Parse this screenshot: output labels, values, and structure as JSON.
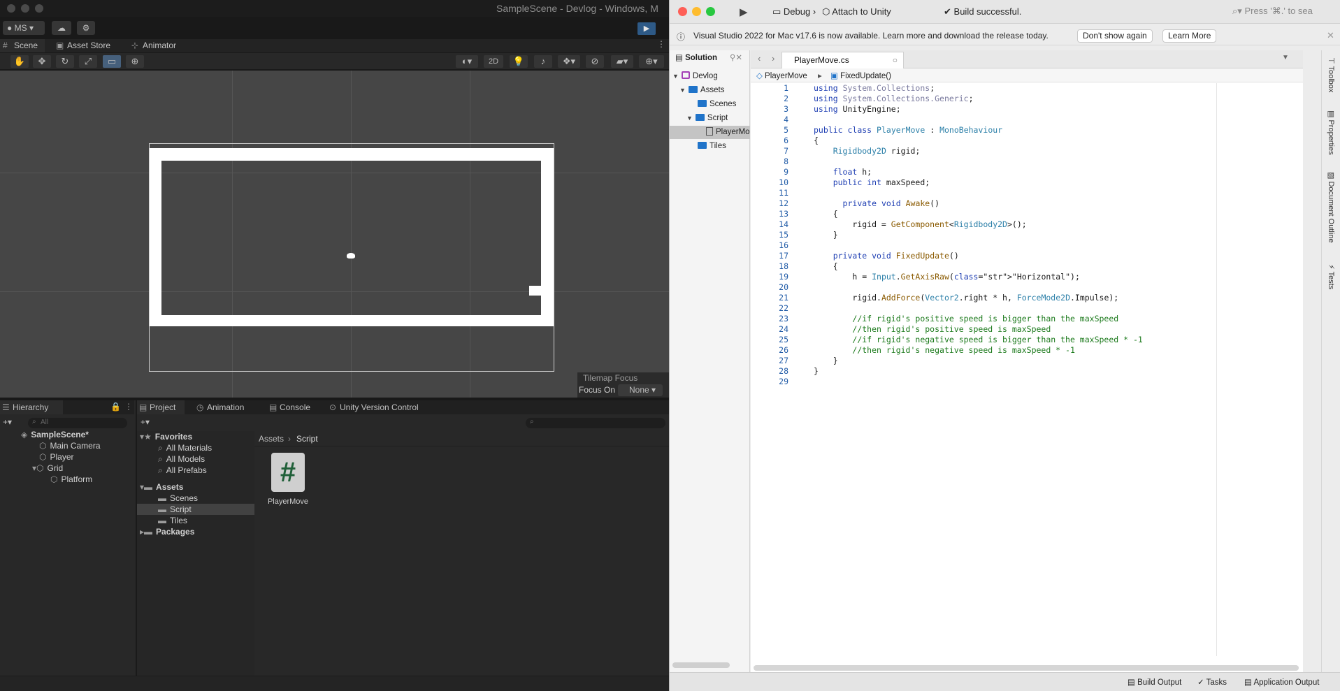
{
  "unity": {
    "window_title": "SampleScene - Devlog - Windows, M",
    "account": "MS",
    "scene_tabs": [
      {
        "label": "Scene",
        "icon": "hash-icon"
      },
      {
        "label": "Asset Store",
        "icon": "bag-icon"
      },
      {
        "label": "Animator",
        "icon": "animator-icon"
      }
    ],
    "scene_toolbar": {
      "mode_2d": "2D"
    },
    "tilemap_focus": {
      "title": "Tilemap Focus",
      "label": "Focus On",
      "value": "None"
    },
    "hierarchy": {
      "tab": "Hierarchy",
      "search_placeholder": "All",
      "items": [
        {
          "label": "SampleScene*"
        },
        {
          "label": "Main Camera"
        },
        {
          "label": "Player"
        },
        {
          "label": "Grid"
        },
        {
          "label": "Platform"
        }
      ]
    },
    "project_tabs": [
      {
        "label": "Project"
      },
      {
        "label": "Animation"
      },
      {
        "label": "Console"
      },
      {
        "label": "Unity Version Control"
      }
    ],
    "project_tree": {
      "favorites": "Favorites",
      "favorite_items": [
        "All Materials",
        "All Models",
        "All Prefabs"
      ],
      "assets": "Assets",
      "asset_items": [
        "Scenes",
        "Script",
        "Tiles"
      ],
      "packages": "Packages"
    },
    "breadcrumb": {
      "root": "Assets",
      "current": "Script"
    },
    "asset": {
      "glyph": "#",
      "label": "PlayerMove"
    }
  },
  "vs": {
    "run_config": "Debug",
    "target": "Attach to Unity",
    "build_status": "Build successful.",
    "search_placeholder": "Press '⌘.' to sea",
    "info": {
      "message": "Visual Studio 2022 for Mac v17.6 is now available. Learn more and download the release today.",
      "dont_show": "Don't show again",
      "learn_more": "Learn More"
    },
    "solution": {
      "title": "Solution",
      "items": [
        {
          "label": "Devlog"
        },
        {
          "label": "Assets"
        },
        {
          "label": "Scenes"
        },
        {
          "label": "Script"
        },
        {
          "label": "PlayerMo"
        },
        {
          "label": "Tiles"
        }
      ]
    },
    "editor": {
      "tab": "PlayerMove.cs",
      "breadcrumb_class": "PlayerMove",
      "breadcrumb_method": "FixedUpdate()"
    },
    "right_bar": [
      "Toolbox",
      "Properties",
      "Document Outline",
      "Tests"
    ],
    "status": {
      "build_output": "Build Output",
      "tasks": "Tasks",
      "app_output": "Application Output"
    },
    "code_lines": [
      "using System.Collections;",
      "using System.Collections.Generic;",
      "using UnityEngine;",
      "",
      "public class PlayerMove : MonoBehaviour",
      "{",
      "    Rigidbody2D rigid;",
      "",
      "    float h;",
      "    public int maxSpeed;",
      "",
      "      private void Awake()",
      "    {",
      "        rigid = GetComponent<Rigidbody2D>();",
      "    }",
      "",
      "    private void FixedUpdate()",
      "    {",
      "        h = Input.GetAxisRaw(\"Horizontal\");",
      "",
      "        rigid.AddForce(Vector2.right * h, ForceMode2D.Impulse);",
      "",
      "        //if rigid's positive speed is bigger than the maxSpeed",
      "        //then rigid's positive speed is maxSpeed",
      "        //if rigid's negative speed is bigger than the maxSpeed * -1",
      "        //then rigid's negative speed is maxSpeed * -1",
      "    }",
      "}",
      ""
    ]
  }
}
